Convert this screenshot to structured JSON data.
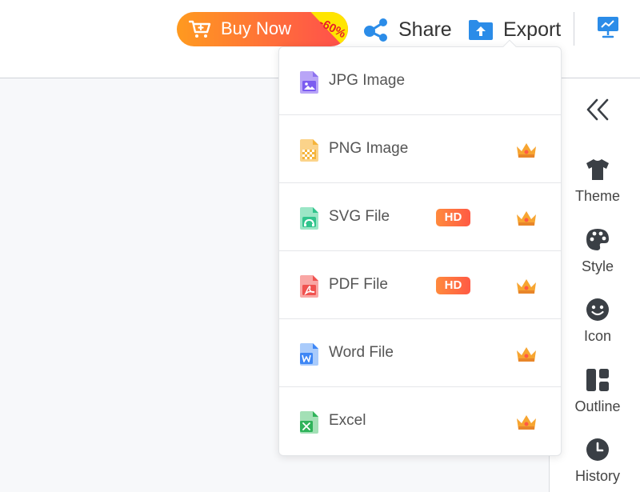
{
  "toolbar": {
    "buy_now_label": "Buy Now",
    "discount_badge": "-60%",
    "share_label": "Share",
    "export_label": "Export"
  },
  "export_menu": {
    "items": [
      {
        "label": "JPG Image",
        "hd": "",
        "premium": false,
        "icon": "jpg-file-icon",
        "color": "#7b5cf0"
      },
      {
        "label": "PNG Image",
        "hd": "",
        "premium": true,
        "icon": "png-file-icon",
        "color": "#f5b43b"
      },
      {
        "label": "SVG File",
        "hd": "HD",
        "premium": true,
        "icon": "svg-file-icon",
        "color": "#31c48d"
      },
      {
        "label": "PDF File",
        "hd": "HD",
        "premium": true,
        "icon": "pdf-file-icon",
        "color": "#f0524f"
      },
      {
        "label": "Word File",
        "hd": "",
        "premium": true,
        "icon": "word-file-icon",
        "color": "#3d86f5"
      },
      {
        "label": "Excel",
        "hd": "",
        "premium": true,
        "icon": "excel-file-icon",
        "color": "#2fb35a"
      }
    ]
  },
  "side_panel": {
    "items": [
      {
        "label": "Theme",
        "icon": "shirt-icon"
      },
      {
        "label": "Style",
        "icon": "palette-icon"
      },
      {
        "label": "Icon",
        "icon": "smiley-icon"
      },
      {
        "label": "Outline",
        "icon": "outline-layout-icon"
      },
      {
        "label": "History",
        "icon": "clock-icon"
      }
    ]
  },
  "colors": {
    "accent_blue": "#2b8ce8",
    "buy_gradient_start": "#ff9a1f",
    "buy_gradient_end": "#ff4d4d",
    "discount_ribbon": "#ffe500",
    "hd_badge": "#ff6a3d",
    "crown": "#f7a531",
    "side_icon": "#3a3f45"
  }
}
